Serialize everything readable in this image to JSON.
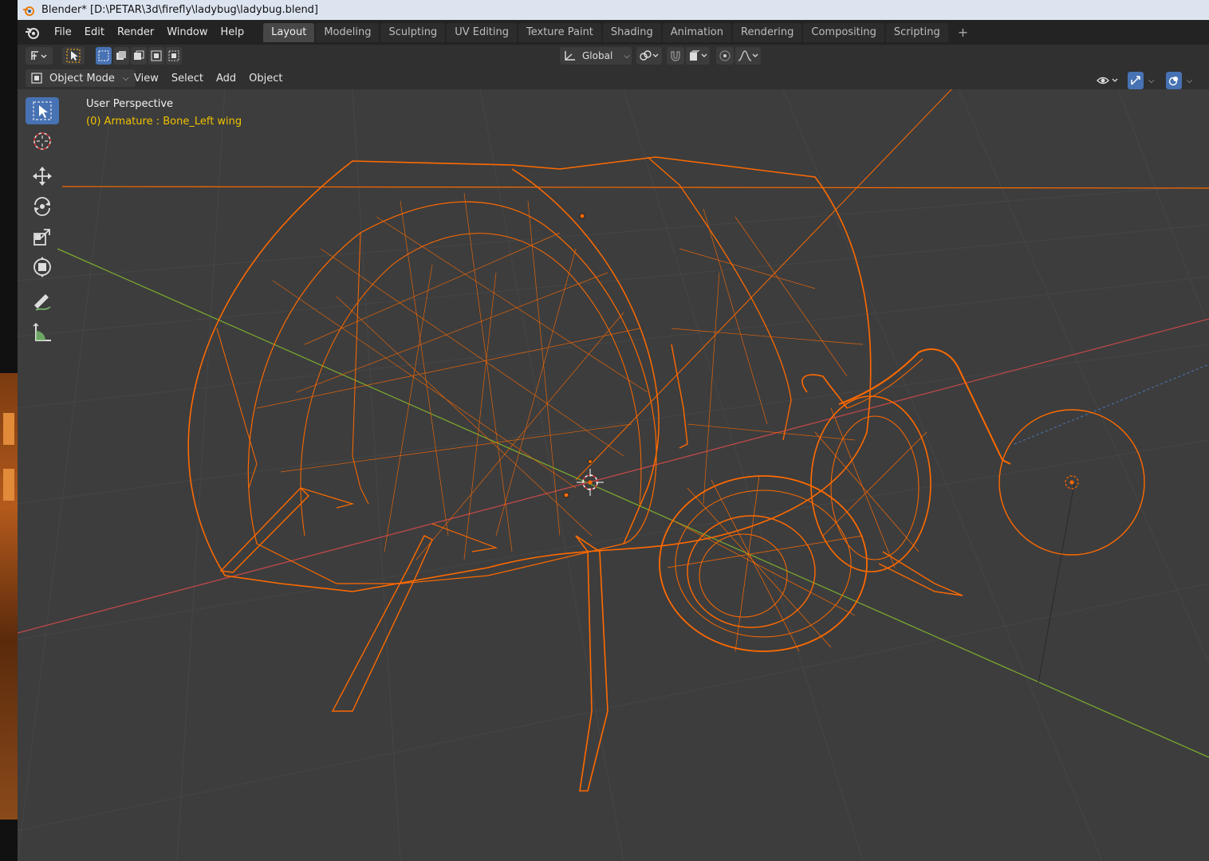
{
  "window": {
    "title": "Blender* [D:\\PETAR\\3d\\firefly\\ladybug\\ladybug.blend]"
  },
  "menubar": {
    "items": [
      "File",
      "Edit",
      "Render",
      "Window",
      "Help"
    ]
  },
  "workspace_tabs": [
    {
      "label": "Layout",
      "active": true
    },
    {
      "label": "Modeling",
      "active": false
    },
    {
      "label": "Sculpting",
      "active": false
    },
    {
      "label": "UV Editing",
      "active": false
    },
    {
      "label": "Texture Paint",
      "active": false
    },
    {
      "label": "Shading",
      "active": false
    },
    {
      "label": "Animation",
      "active": false
    },
    {
      "label": "Rendering",
      "active": false
    },
    {
      "label": "Compositing",
      "active": false
    },
    {
      "label": "Scripting",
      "active": false
    }
  ],
  "tool_header": {
    "transform_orientation": "Global"
  },
  "viewport_header": {
    "mode": "Object Mode",
    "menus": [
      "View",
      "Select",
      "Add",
      "Object"
    ]
  },
  "viewport": {
    "perspective_label": "User Perspective",
    "active_object_label": "(0) Armature : Bone_Left wing"
  },
  "toolbar_tools": [
    {
      "icon": "select-box-icon",
      "active": true
    },
    {
      "icon": "cursor-icon",
      "active": false
    },
    {
      "icon": "move-icon",
      "active": false
    },
    {
      "icon": "rotate-icon",
      "active": false
    },
    {
      "icon": "scale-icon",
      "active": false
    },
    {
      "icon": "transform-icon",
      "active": false
    },
    {
      "icon": "annotate-icon",
      "active": false
    },
    {
      "icon": "measure-icon",
      "active": false
    }
  ],
  "colors": {
    "wire": "#ff6a00",
    "x_axis": "#d04848",
    "y_axis": "#7aa62f",
    "active_tab": "#474747",
    "active_tool": "#4772b3",
    "info_highlight": "#f0c200"
  }
}
